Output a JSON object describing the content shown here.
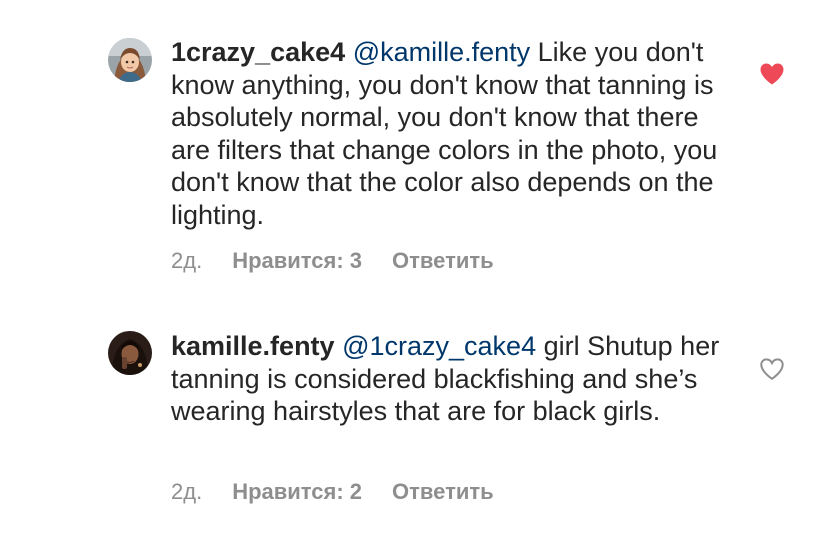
{
  "comments": [
    {
      "username": "1crazy_cake4",
      "mention": "@kamille.fenty",
      "text": " Like you don't know anything, you don't know that tanning is absolutely normal, you don't know that there are filters that change colors in the photo, you don't know that the color also depends on the lighting.",
      "time": "2д.",
      "likes_label": "Нравится: 3",
      "reply_label": "Ответить",
      "liked": true,
      "heart_icon": "heart-filled-icon",
      "heart_color": "#ed4956"
    },
    {
      "username": "kamille.fenty",
      "mention": "@1crazy_cake4",
      "text": " girl Shutup her tanning is considered blackfishing and she’s wearing hairstyles that are for black girls.",
      "time": "2д.",
      "likes_label": "Нравится: 2",
      "reply_label": "Ответить",
      "liked": false,
      "heart_icon": "heart-outline-icon",
      "heart_color": "#8e8e8e"
    }
  ],
  "colors": {
    "text": "#262626",
    "mention": "#00376b",
    "meta": "#8e8e8e",
    "liked_heart": "#ed4956"
  }
}
